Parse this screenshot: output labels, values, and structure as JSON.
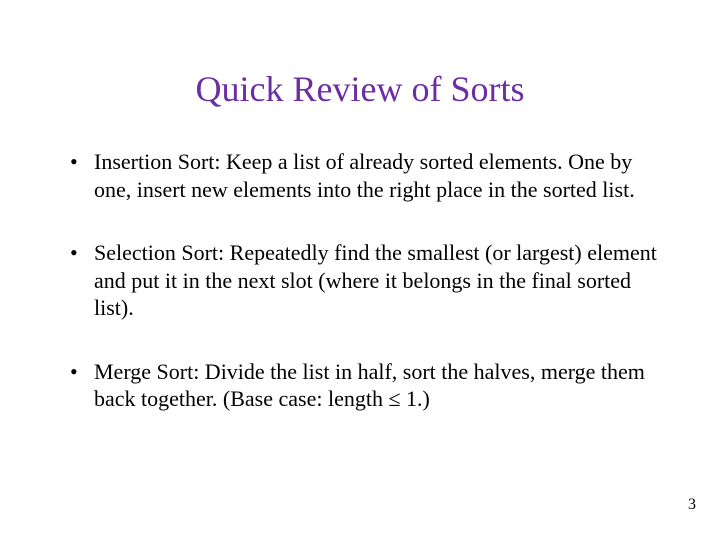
{
  "title": "Quick Review of Sorts",
  "bullets": [
    "Insertion Sort: Keep a list of already sorted elements.  One by one, insert new elements into the right place in the sorted list.",
    "Selection Sort: Repeatedly find the smallest (or largest) element and put it in the next slot (where it belongs in the final sorted list).",
    "Merge Sort: Divide the list in half, sort the halves, merge them back together.  (Base case: length ≤ 1.)"
  ],
  "page_number": "3"
}
